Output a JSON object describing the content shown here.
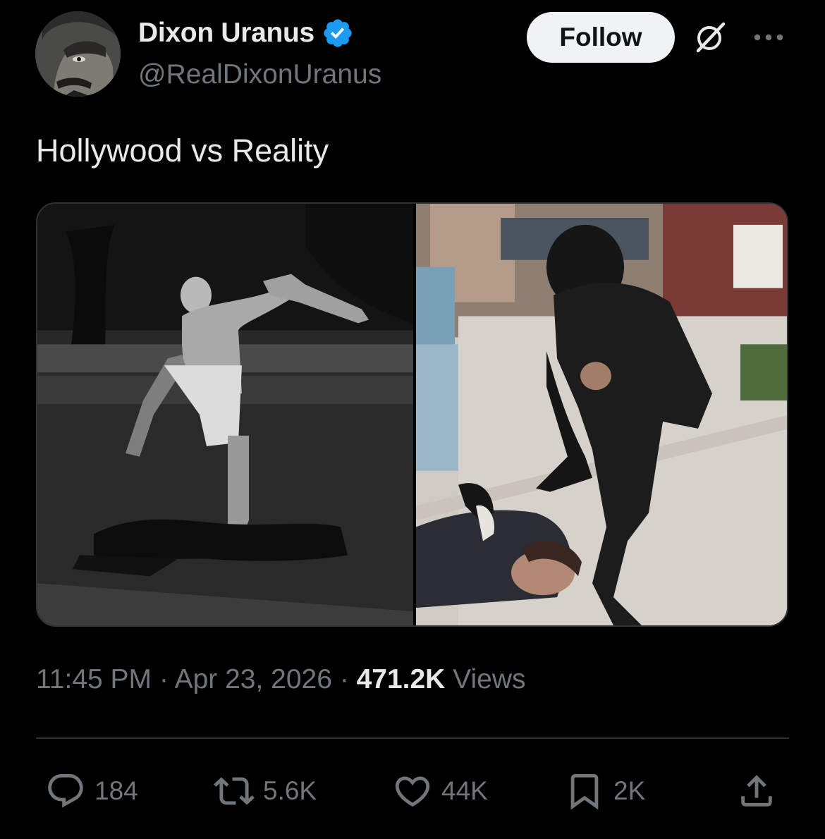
{
  "author": {
    "display_name": "Dixon Uranus",
    "handle": "@RealDixonUranus",
    "verified": true
  },
  "header": {
    "follow_label": "Follow",
    "grok_icon": "grok-icon",
    "more_icon": "more-dots-icon"
  },
  "tweet": {
    "text": "Hollywood vs Reality"
  },
  "meta": {
    "time": "11:45 PM",
    "sep1": " · ",
    "date": "Apr 23, 2026",
    "sep2": " · ",
    "views_count": "471.2K",
    "views_label": " Views"
  },
  "actions": {
    "replies": "184",
    "reposts": "5.6K",
    "likes": "44K",
    "bookmarks": "2K"
  },
  "colors": {
    "background": "#000000",
    "text_primary": "#e7e9ea",
    "text_secondary": "#71767b",
    "verified_blue": "#1d9bf0",
    "divider": "#2f3336"
  }
}
